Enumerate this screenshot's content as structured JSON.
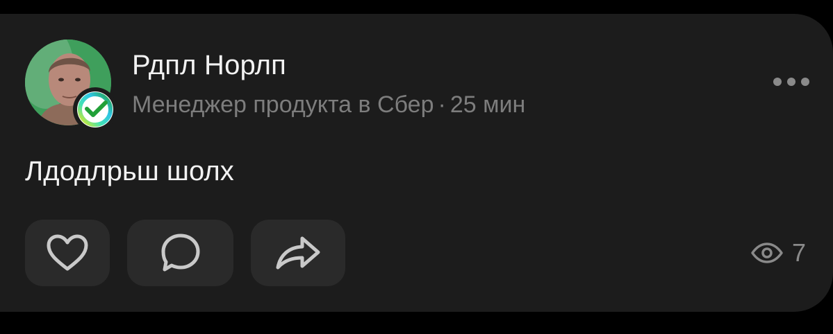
{
  "post": {
    "author": {
      "name": "Рдпл Норлп",
      "position": "Менеджер продукта в Сбер",
      "separator": "·",
      "time": "25 мин",
      "avatar_icon": "user-photo",
      "badge_icon": "sber-check-badge"
    },
    "menu_icon": "more-dots-icon",
    "text": "Лдодлрьш шолх",
    "actions": {
      "like_icon": "heart-icon",
      "comment_icon": "comment-bubble-icon",
      "share_icon": "share-arrow-icon"
    },
    "views": {
      "icon": "eye-icon",
      "count": "7"
    }
  },
  "colors": {
    "background": "#000000",
    "card": "#1c1c1c",
    "button": "#2a2a2a",
    "primary_text": "#f2f2f2",
    "secondary_text": "#7d7d7d",
    "sber_green": "#21a038"
  }
}
